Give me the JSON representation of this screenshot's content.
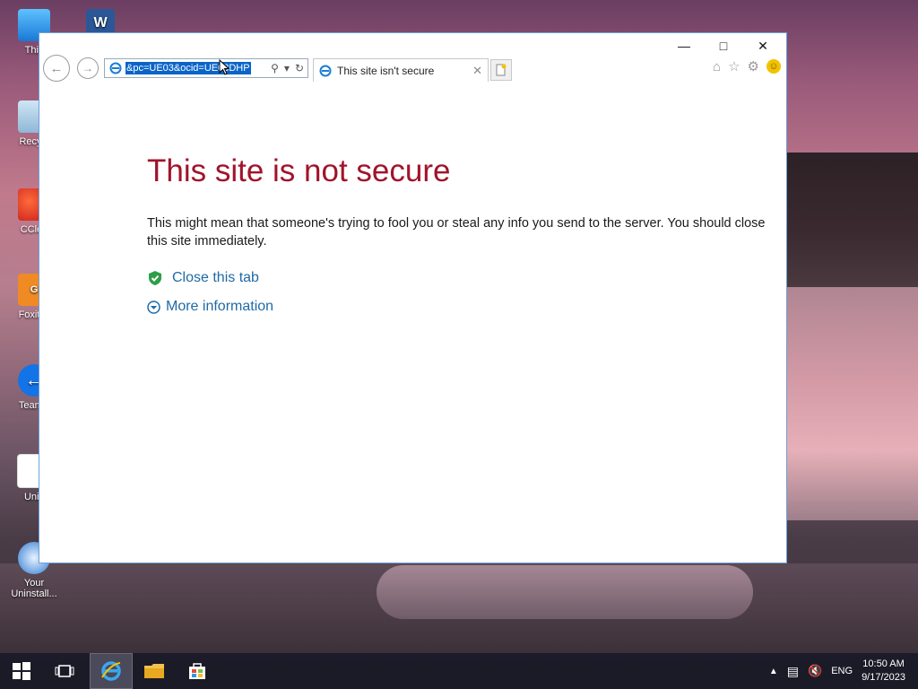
{
  "desktop": {
    "icons": [
      {
        "label": "This"
      },
      {
        "label": "Recycl"
      },
      {
        "label": "CClea"
      },
      {
        "label": "Foxit R"
      },
      {
        "label": "TeamV"
      },
      {
        "label": "Unik"
      },
      {
        "label": "Your Uninstall..."
      }
    ]
  },
  "browser": {
    "address_value": "&pc=UE03&ocid=UE03DHP",
    "tab_title": "This site isn't secure",
    "page": {
      "heading": "This site is not secure",
      "message": "This might mean that someone's trying to fool you or steal any info you send to the server. You should close this site immediately.",
      "close_tab_label": "Close this tab",
      "more_info_label": "More information"
    },
    "colors": {
      "heading": "#a1142b",
      "link": "#1f6aa6",
      "selection": "#0a64c8"
    }
  },
  "taskbar": {
    "language": "ENG",
    "time": "10:50 AM",
    "date": "9/17/2023"
  }
}
